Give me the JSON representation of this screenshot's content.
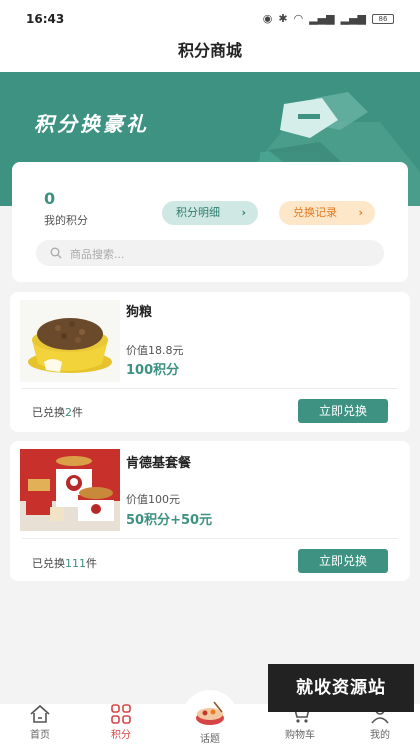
{
  "status_bar": {
    "time": "16:43",
    "battery": "86"
  },
  "header": {
    "title": "积分商城"
  },
  "banner": {
    "text": "积分换豪礼"
  },
  "points": {
    "value": "0",
    "label": "我的积分",
    "detail_button": "积分明细",
    "record_button": "兑换记录"
  },
  "search": {
    "placeholder": "商品搜索..."
  },
  "products": [
    {
      "name": "狗粮",
      "price": "价值18.8元",
      "points": "100积分",
      "sold_prefix": "已兑换",
      "sold_count": "2",
      "sold_suffix": "件",
      "button": "立即兑换"
    },
    {
      "name": "肯德基套餐",
      "price": "价值100元",
      "points": "50积分+50元",
      "sold_prefix": "已兑换",
      "sold_count": "111",
      "sold_suffix": "件",
      "button": "立即兑换"
    }
  ],
  "tabbar": {
    "home": "首页",
    "points": "积分",
    "topic": "话题",
    "cart": "购物车",
    "mine": "我的"
  },
  "watermark": "就收资源站",
  "colors": {
    "brand": "#3d9281",
    "active_tab": "#d64545"
  }
}
